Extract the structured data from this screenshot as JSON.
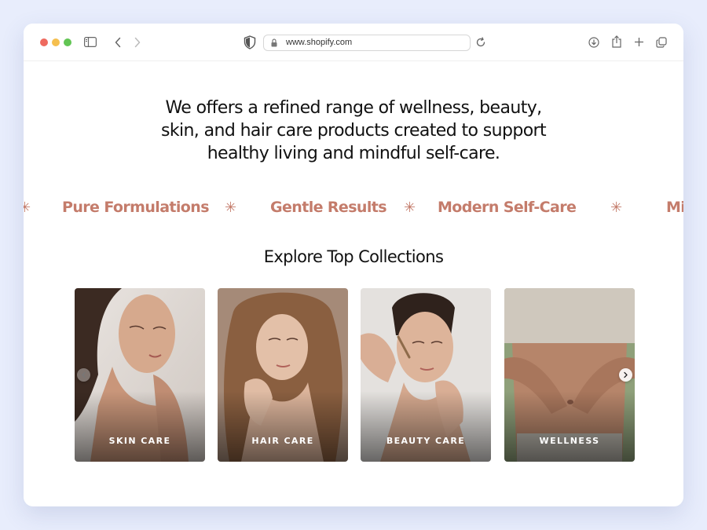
{
  "browser": {
    "url": "www.shopify.com"
  },
  "hero": {
    "line1": "We offers a refined range of wellness, beauty,",
    "line2": "skin, and hair care products created to support",
    "line3": "healthy living and mindful self-care."
  },
  "marquee": {
    "items": [
      "Pure Formulations",
      "Gentle Results",
      "Modern Self-Care",
      "Mi"
    ],
    "separator": "✳"
  },
  "collections": {
    "title": "Explore Top Collections",
    "cards": [
      {
        "label": "SKIN CARE"
      },
      {
        "label": "HAIR CARE"
      },
      {
        "label": "BEAUTY CARE"
      },
      {
        "label": "WELLNESS"
      }
    ]
  },
  "colors": {
    "accent": "#c47c6b",
    "background": "#e8edfc"
  }
}
